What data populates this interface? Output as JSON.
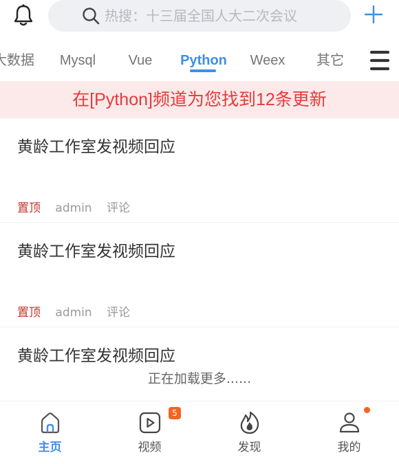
{
  "header": {
    "search_placeholder": "热搜：十三届全国人大二次会议"
  },
  "tabs": [
    {
      "label": "大数据"
    },
    {
      "label": "Mysql"
    },
    {
      "label": "Vue"
    },
    {
      "label": "Python"
    },
    {
      "label": "Weex"
    },
    {
      "label": "其它"
    }
  ],
  "active_tab": "Python",
  "notice": "在[Python]频道为您找到12条更新",
  "articles": [
    {
      "title": "黄龄工作室发视频回应",
      "pin": "置顶",
      "author": "admin",
      "comment": "评论"
    },
    {
      "title": "黄龄工作室发视频回应",
      "pin": "置顶",
      "author": "admin",
      "comment": "评论"
    },
    {
      "title": "黄龄工作室发视频回应"
    }
  ],
  "loading_text": "正在加载更多......",
  "bottom_nav": [
    {
      "label": "主页",
      "icon": "home-icon"
    },
    {
      "label": "视频",
      "icon": "video-icon",
      "badge": "5"
    },
    {
      "label": "发现",
      "icon": "fire-icon"
    },
    {
      "label": "我的",
      "icon": "user-icon",
      "dot": true
    }
  ],
  "colors": {
    "accent": "#3e8fe6",
    "notice_bg": "#fce9e9",
    "notice_text": "#e43b3b",
    "pin": "#c0392b",
    "badge": "#f26522"
  }
}
